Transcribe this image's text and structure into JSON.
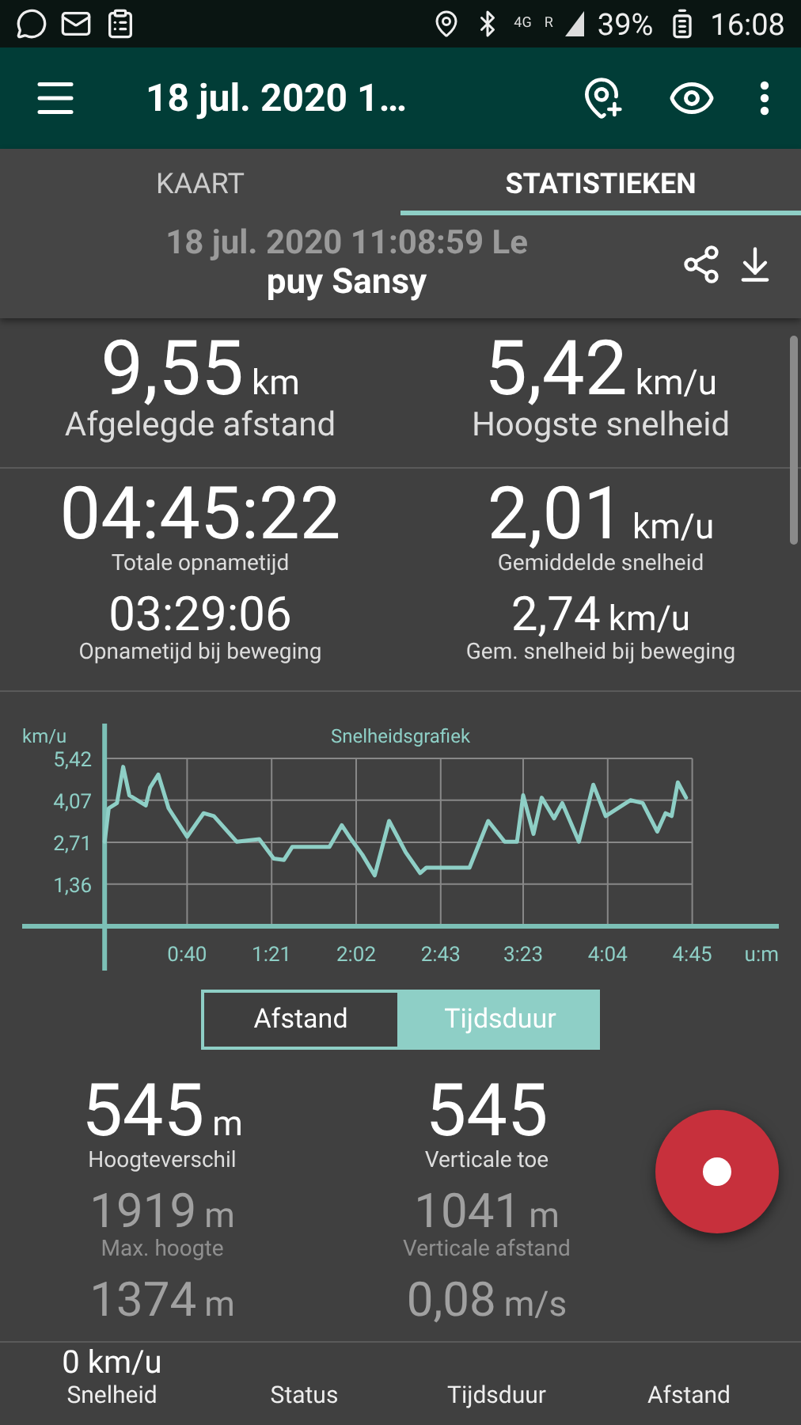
{
  "status_bar": {
    "network": "4G",
    "roaming": "R",
    "battery": "39%",
    "time": "16:08"
  },
  "app_bar": {
    "title": "18 jul. 2020 1…"
  },
  "tabs": [
    {
      "label": "KAART",
      "selected": false
    },
    {
      "label": "STATISTIEKEN",
      "selected": true
    }
  ],
  "track": {
    "title": "18 jul. 2020 11:08:59 Le",
    "subtitle": "puy Sansy"
  },
  "summary": [
    {
      "items": [
        {
          "value": "9,55",
          "unit": "km",
          "label": "Afgelegde afstand",
          "kind": "headline"
        },
        {
          "value": "5,42",
          "unit": "km/u",
          "label": "Hoogste snelheid",
          "kind": "headline"
        }
      ]
    },
    {
      "items": [
        {
          "value": "04:45:22",
          "label": "Totale opnametijd",
          "kind": "large"
        },
        {
          "value": "2,01",
          "unit": "km/u",
          "label": "Gemiddelde snelheid",
          "kind": "large"
        },
        {
          "value": "03:29:06",
          "label": "Opnametijd bij beweging",
          "kind": "medium"
        },
        {
          "value": "2,74",
          "unit": "km/u",
          "label": "Gem. snelheid bij beweging",
          "kind": "medium"
        }
      ]
    }
  ],
  "chart": {
    "chart_data": {
      "type": "line",
      "title": "Snelheidsgrafiek",
      "xlabel": "u:m",
      "ylabel": "km/u",
      "xlim": [
        -40,
        327
      ],
      "grid": true,
      "ylim": [
        0,
        5.42
      ],
      "xticks": [
        {
          "value": 40,
          "label": "0:40"
        },
        {
          "value": 81,
          "label": "1:21"
        },
        {
          "value": 122,
          "label": "2:02"
        },
        {
          "value": 163,
          "label": "2:43"
        },
        {
          "value": 203,
          "label": "3:23"
        },
        {
          "value": 244,
          "label": "4:04"
        },
        {
          "value": 285,
          "label": "4:45"
        }
      ],
      "yticks": [
        {
          "value": 1.36,
          "label": "1,36"
        },
        {
          "value": 2.71,
          "label": "2,71"
        },
        {
          "value": 4.07,
          "label": "4,07"
        },
        {
          "value": 5.42,
          "label": "5,42"
        }
      ],
      "x": [
        0,
        2,
        6,
        9,
        12,
        20,
        22,
        26,
        31,
        40,
        48,
        53,
        64,
        75,
        82,
        87,
        91,
        109,
        115,
        119,
        125,
        131,
        138,
        146,
        153,
        156,
        177,
        186,
        194,
        200,
        203,
        208,
        212,
        218,
        222,
        230,
        237,
        243,
        255,
        261,
        268,
        272,
        275,
        278,
        282
      ],
      "series": [
        {
          "color": "#8ecfc6",
          "values": [
            2.73,
            3.81,
            3.98,
            5.15,
            4.23,
            3.9,
            4.48,
            4.9,
            3.81,
            2.89,
            3.65,
            3.56,
            2.73,
            2.81,
            2.19,
            2.14,
            2.56,
            2.56,
            3.26,
            2.86,
            2.31,
            1.64,
            3.4,
            2.39,
            1.72,
            1.89,
            1.89,
            3.4,
            2.73,
            2.73,
            4.23,
            2.98,
            4.15,
            3.48,
            3.98,
            2.73,
            4.57,
            3.56,
            4.07,
            3.98,
            3.06,
            3.65,
            3.56,
            4.65,
            4.15
          ]
        }
      ]
    }
  },
  "axis_toggle": [
    {
      "label": "Afstand",
      "selected": false
    },
    {
      "label": "Tijdsduur",
      "selected": true
    }
  ],
  "elevation": [
    {
      "value": "545",
      "unit": "m",
      "label": "Hoogteverschil",
      "kind": "large"
    },
    {
      "value": "545",
      "label": "Verticale toe",
      "kind": "large"
    },
    {
      "value": "1919",
      "unit": "m",
      "label": "Max. hoogte",
      "kind": "faded"
    },
    {
      "value": "1041",
      "unit": "m",
      "label": "Verticale afstand",
      "kind": "faded"
    },
    {
      "value": "1374",
      "unit": "m",
      "kind": "faded"
    },
    {
      "value": "0,08",
      "unit": "m/s",
      "kind": "faded"
    }
  ],
  "bottom_bar": {
    "speed": "0 km/u",
    "labels": [
      "Snelheid",
      "Status",
      "Tijdsduur",
      "Afstand"
    ]
  }
}
